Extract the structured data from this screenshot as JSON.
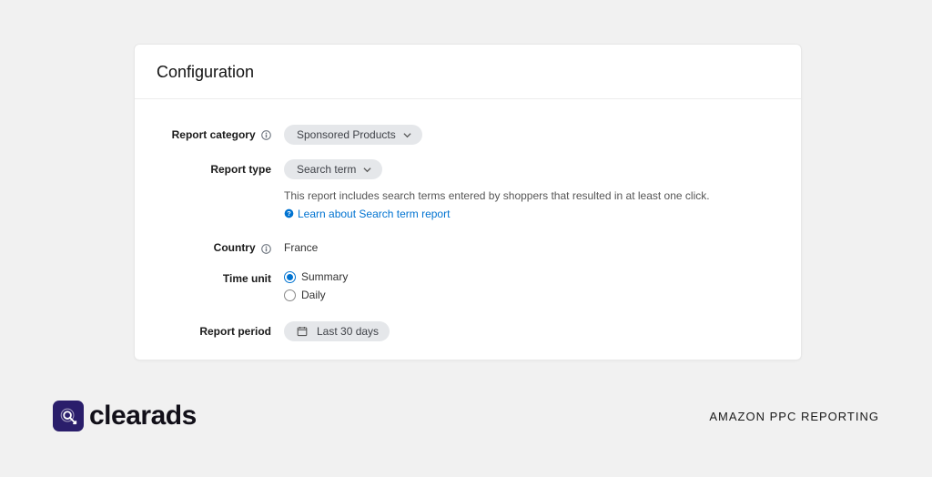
{
  "card": {
    "title": "Configuration"
  },
  "form": {
    "report_category": {
      "label": "Report category",
      "value": "Sponsored Products"
    },
    "report_type": {
      "label": "Report type",
      "value": "Search term",
      "description": "This report includes search terms entered by shoppers that resulted in at least one click.",
      "learn_link": "Learn about Search term report"
    },
    "country": {
      "label": "Country",
      "value": "France"
    },
    "time_unit": {
      "label": "Time unit",
      "options": [
        "Summary",
        "Daily"
      ],
      "selected": "Summary"
    },
    "report_period": {
      "label": "Report period",
      "value": "Last 30 days"
    }
  },
  "footer": {
    "brand": "clearads",
    "tagline": "AMAZON PPC REPORTING"
  }
}
